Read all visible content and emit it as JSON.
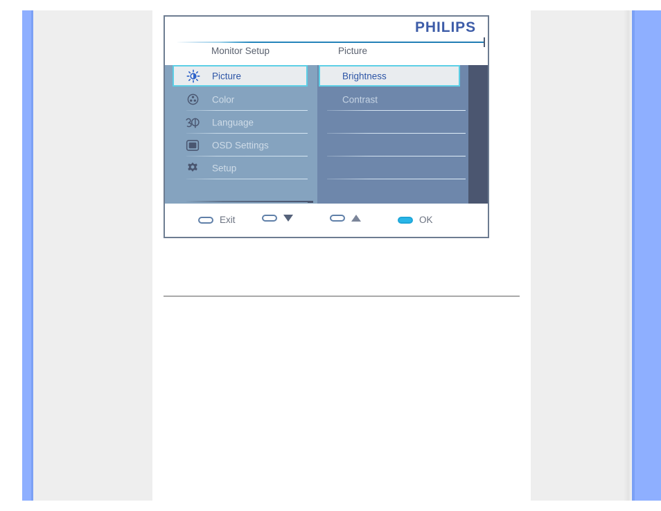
{
  "brand": {
    "logo_text": "PHILIPS",
    "logo_color": "#3d5ca8"
  },
  "osd": {
    "columns": {
      "left_caption": "Monitor Setup",
      "right_caption": "Picture"
    },
    "menu_items": [
      {
        "label": "Picture",
        "icon": "brightness-icon",
        "selected": true
      },
      {
        "label": "Color",
        "icon": "color-wheel-icon",
        "selected": false
      },
      {
        "label": "Language",
        "icon": "language-icon",
        "selected": false
      },
      {
        "label": "OSD Settings",
        "icon": "osd-screen-icon",
        "selected": false
      },
      {
        "label": "Setup",
        "icon": "gear-icon",
        "selected": false
      },
      {
        "label": "",
        "icon": "",
        "selected": false
      }
    ],
    "value_items": [
      {
        "label": "Brightness",
        "selected": true
      },
      {
        "label": "Contrast",
        "selected": false
      },
      {
        "label": "",
        "selected": false
      },
      {
        "label": "",
        "selected": false
      },
      {
        "label": "",
        "selected": false
      },
      {
        "label": "",
        "selected": false
      }
    ],
    "footer_buttons": [
      {
        "label": "Exit",
        "icon": "pill-button",
        "filled": false,
        "arrow": "none"
      },
      {
        "label": "",
        "icon": "pill-button",
        "filled": false,
        "arrow": "down"
      },
      {
        "label": "",
        "icon": "pill-button",
        "filled": false,
        "arrow": "up"
      },
      {
        "label": "OK",
        "icon": "pill-button-active",
        "filled": true,
        "arrow": "none"
      }
    ],
    "colors": {
      "panel_left": "#85a3bf",
      "panel_mid": "#6e87ab",
      "panel_dark": "#4b5670",
      "highlight_border": "#5ccfe6",
      "highlight_bg": "#e9ecef",
      "highlight_text": "#2d55a6",
      "accent_ok": "#29b6e8"
    }
  }
}
